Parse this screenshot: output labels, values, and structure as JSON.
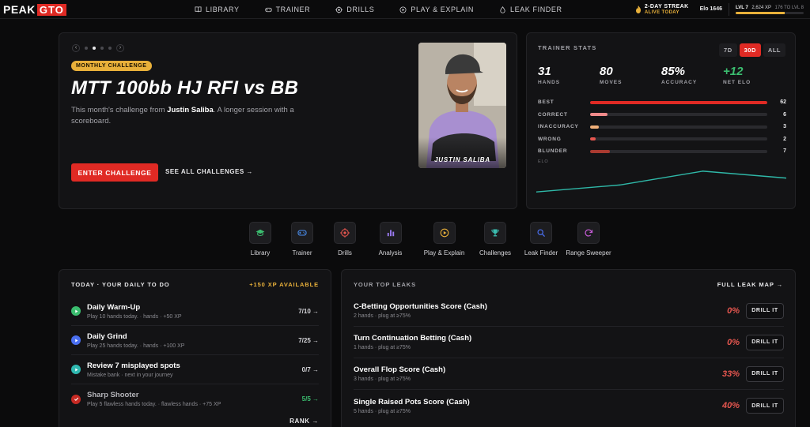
{
  "nav": {
    "logo_text": "PEAK",
    "logo_box": "GTO",
    "links": [
      {
        "label": "LIBRARY",
        "icon": "book-icon"
      },
      {
        "label": "TRAINER",
        "icon": "gamepad-icon"
      },
      {
        "label": "DRILLS",
        "icon": "target-icon"
      },
      {
        "label": "PLAY & EXPLAIN",
        "icon": "play-circle-icon"
      },
      {
        "label": "LEAK FINDER",
        "icon": "drop-icon"
      }
    ],
    "streak_title": "2-DAY STREAK",
    "streak_sub": "ALIVE TODAY",
    "elo": "Elo 1646",
    "level": "LVL 7",
    "xp": "2,624 XP",
    "xp_to_next": "176 TO LVL 8",
    "xp_progress": 0.72
  },
  "hero": {
    "badge": "MONTHLY CHALLENGE",
    "title": "MTT 100bb HJ RFI vs BB",
    "desc_pre": "This month's challenge from ",
    "desc_name": "Justin Saliba",
    "desc_post": ". A longer session with a scoreboard.",
    "enter_label": "ENTER CHALLENGE",
    "see_all_label": "SEE ALL CHALLENGES →",
    "photo_name": "JUSTIN SALIBA",
    "carousel_active": 1
  },
  "stats": {
    "title": "TRAINER STATS",
    "ranges": [
      "7D",
      "30D",
      "ALL"
    ],
    "active_range": "30D",
    "kpis": [
      {
        "value": "31",
        "label": "HANDS"
      },
      {
        "value": "80",
        "label": "MOVES"
      },
      {
        "value": "85%",
        "label": "ACCURACY"
      },
      {
        "value": "+12",
        "label": "NET ELO"
      }
    ],
    "bars": [
      {
        "label": "BEST",
        "value": 62,
        "color": "#e02a24"
      },
      {
        "label": "CORRECT",
        "value": 6,
        "color": "#f08a8a"
      },
      {
        "label": "INACCURACY",
        "value": 3,
        "color": "#f0b07a"
      },
      {
        "label": "WRONG",
        "value": 2,
        "color": "#e5564f"
      },
      {
        "label": "BLUNDER",
        "value": 7,
        "color": "#a93a30"
      }
    ],
    "bar_max": 62,
    "elo_label": "ELO"
  },
  "chart_data": {
    "type": "line",
    "title": "",
    "xlabel": "",
    "ylabel": "ELO",
    "series": [
      {
        "values": [
          1634,
          1640,
          1652,
          1646
        ]
      }
    ],
    "x": [
      0,
      1,
      2,
      3
    ],
    "ylim": [
      1630,
      1656
    ]
  },
  "tools": [
    {
      "label": "Library",
      "icon": "graduation-cap-icon",
      "color": "#3bbd6f"
    },
    {
      "label": "Trainer",
      "icon": "gamepad-icon",
      "color": "#4a8ff0"
    },
    {
      "label": "Drills",
      "icon": "target-icon",
      "color": "#e5564f"
    },
    {
      "label": "Analysis",
      "icon": "bar-chart-icon",
      "color": "#9a7af0"
    },
    {
      "label": "Play & Explain",
      "icon": "play-circle-icon",
      "color": "#e8b03a"
    },
    {
      "label": "Challenges",
      "icon": "trophy-icon",
      "color": "#3bbdb0"
    },
    {
      "label": "Leak Finder",
      "icon": "magnifier-icon",
      "color": "#4a6ff0"
    },
    {
      "label": "Range Sweeper",
      "icon": "refresh-icon",
      "color": "#c05ad0"
    }
  ],
  "today": {
    "title": "TODAY · YOUR DAILY TO DO",
    "xp_available": "+150 XP AVAILABLE",
    "tasks": [
      {
        "title": "Daily Warm-Up",
        "sub": "Play 10 hands today. · hands · +50 XP",
        "progress": "7/10 →",
        "color": "#3bbd6f",
        "icon": "play-icon",
        "done": false
      },
      {
        "title": "Daily Grind",
        "sub": "Play 25 hands today. · hands · +100 XP",
        "progress": "7/25 →",
        "color": "#4a6ff0",
        "icon": "play-icon",
        "done": false
      },
      {
        "title": "Review 7 misplayed spots",
        "sub": "Mistake bank · next in your journey",
        "progress": "0/7 →",
        "color": "#2fb8b0",
        "icon": "play-icon",
        "done": false
      },
      {
        "title": "Sharp Shooter",
        "sub": "Play 5 flawless hands today. · flawless hands · +75 XP",
        "progress": "5/5 →",
        "color": "#c62a24",
        "icon": "check-icon",
        "done": true
      }
    ],
    "rank_label": "RANK →"
  },
  "leaks": {
    "title": "YOUR TOP LEAKS",
    "map_label": "FULL LEAK MAP →",
    "drill_label": "DRILL IT",
    "items": [
      {
        "title": "C-Betting Opportunities Score (Cash)",
        "sub": "2 hands · plug at ≥75%",
        "pct": "0%"
      },
      {
        "title": "Turn Continuation Betting (Cash)",
        "sub": "1 hands · plug at ≥75%",
        "pct": "0%"
      },
      {
        "title": "Overall Flop Score (Cash)",
        "sub": "3 hands · plug at ≥75%",
        "pct": "33%"
      },
      {
        "title": "Single Raised Pots Score (Cash)",
        "sub": "5 hands · plug at ≥75%",
        "pct": "40%"
      }
    ]
  }
}
